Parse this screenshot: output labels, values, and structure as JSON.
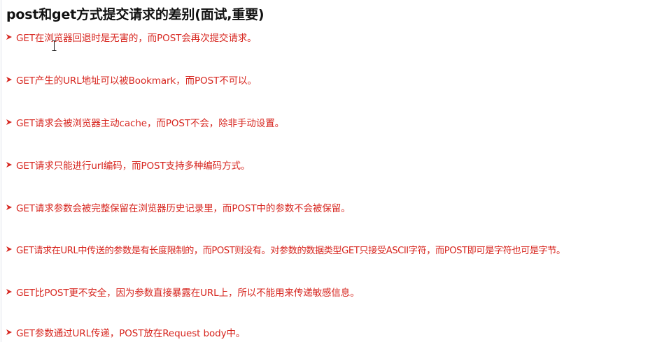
{
  "title": "post和get方式提交请求的差别(面试,重要)",
  "bullet_icon": "arrow-bullet-icon",
  "colors": {
    "title": "#111111",
    "bullet_text": "#d7261f",
    "arrow": "#d7261f"
  },
  "bullets": [
    "GET在浏览器回退时是无害的，而POST会再次提交请求。",
    "GET产生的URL地址可以被Bookmark，而POST不可以。",
    "GET请求会被浏览器主动cache，而POST不会，除非手动设置。",
    "GET请求只能进行url编码，而POST支持多种编码方式。",
    "GET请求参数会被完整保留在浏览器历史记录里，而POST中的参数不会被保留。",
    "GET请求在URL中传送的参数是有长度限制的，而POST则没有。对参数的数据类型GET只接受ASCII字符，而POST即可是字符也可是字节。",
    "GET比POST更不安全，因为参数直接暴露在URL上，所以不能用来传递敏感信息。",
    "GET参数通过URL传递，POST放在Request body中。"
  ]
}
